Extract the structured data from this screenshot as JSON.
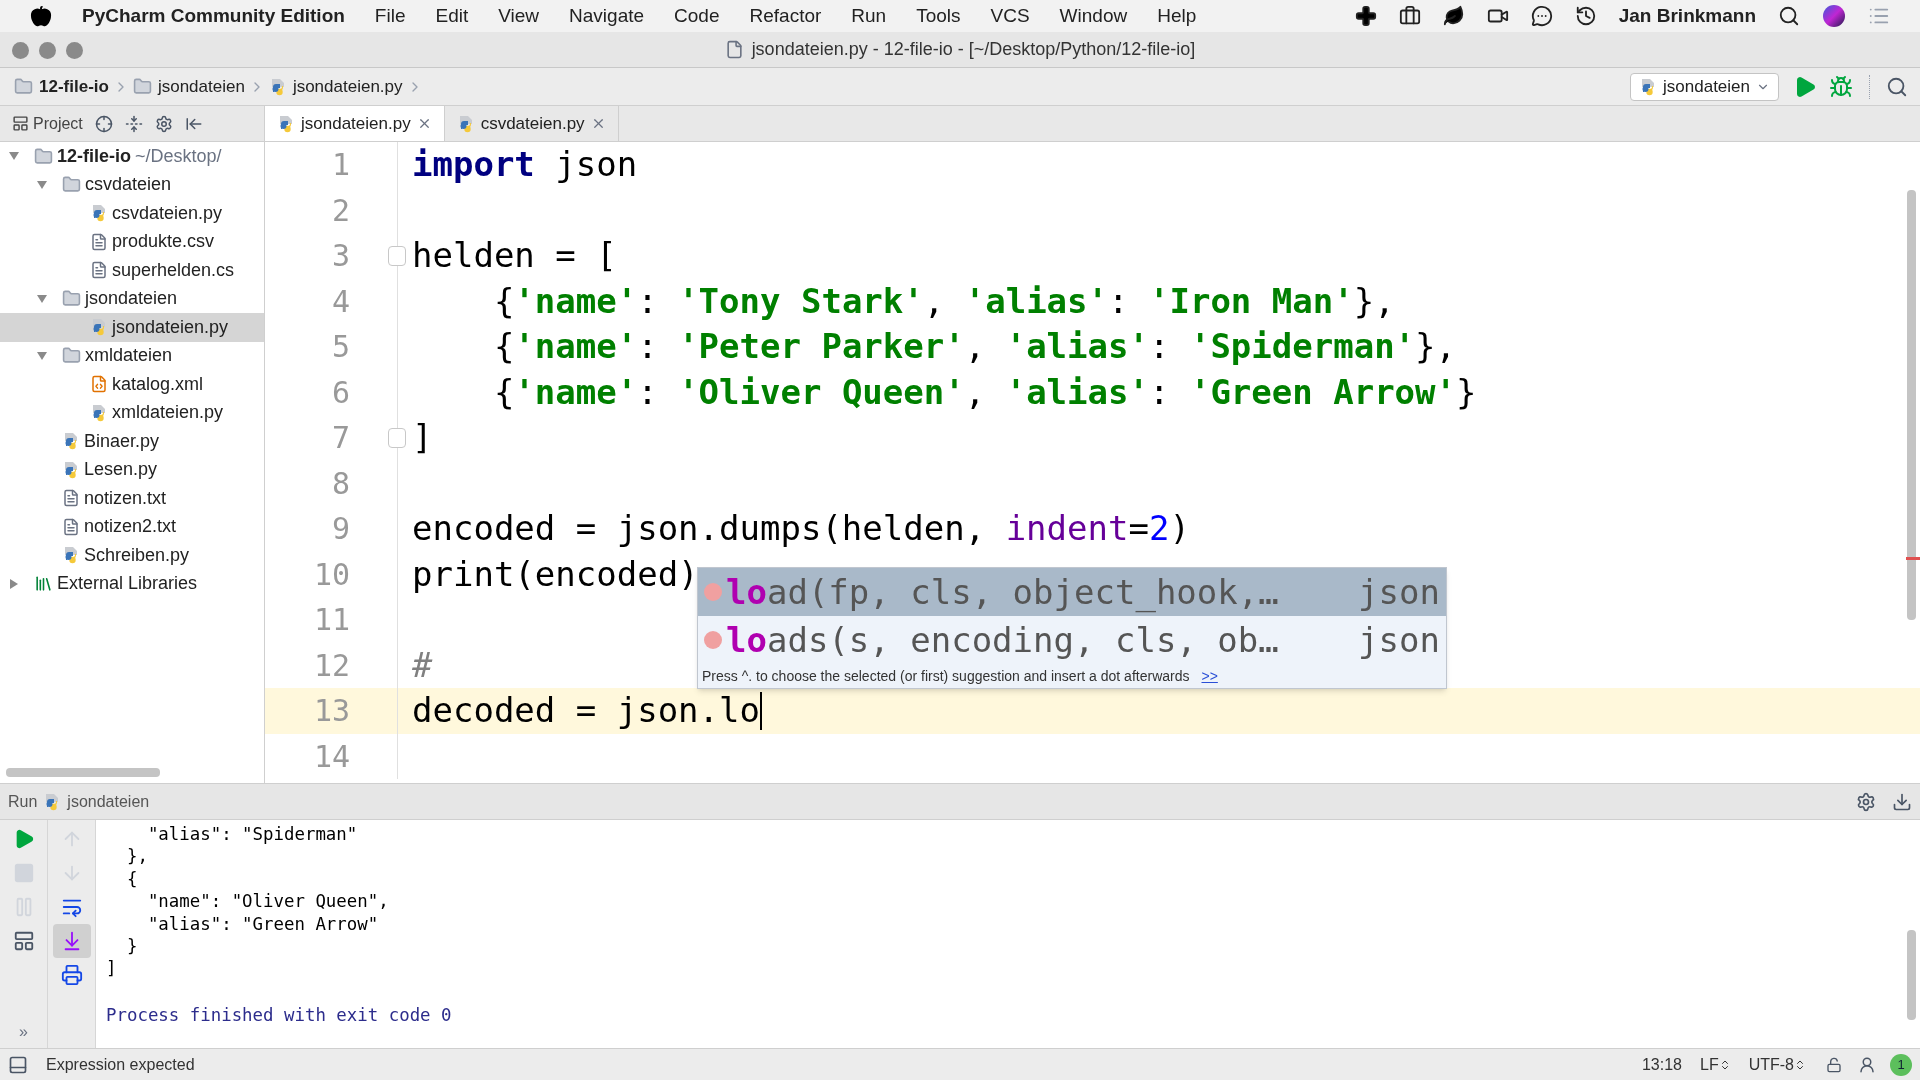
{
  "menu_bar": {
    "app_name": "PyCharm Community Edition",
    "menus": [
      "File",
      "Edit",
      "View",
      "Navigate",
      "Code",
      "Refactor",
      "Run",
      "Tools",
      "VCS",
      "Window",
      "Help"
    ],
    "user": "Jan Brinkmann"
  },
  "window": {
    "title": "jsondateien.py - 12-file-io - [~/Desktop/Python/12-file-io]"
  },
  "breadcrumbs": [
    {
      "label": "12-file-io",
      "kind": "folder"
    },
    {
      "label": "jsondateien",
      "kind": "folder"
    },
    {
      "label": "jsondateien.py",
      "kind": "python"
    }
  ],
  "run_config": {
    "label": "jsondateien"
  },
  "project_panel": {
    "label": "Project"
  },
  "tabs": [
    {
      "label": "jsondateien.py",
      "selected": true
    },
    {
      "label": "csvdateien.py",
      "selected": false
    }
  ],
  "project_tree": [
    {
      "name": "12-file-io",
      "suffix": "~/Desktop/",
      "kind": "root",
      "expanded": true,
      "selected": false,
      "children": [
        {
          "name": "csvdateien",
          "kind": "folder",
          "expanded": true,
          "selected": false,
          "children": [
            {
              "name": "csvdateien.py",
              "kind": "python",
              "selected": false
            },
            {
              "name": "produkte.csv",
              "kind": "text",
              "selected": false
            },
            {
              "name": "superhelden.cs",
              "kind": "text",
              "selected": false
            }
          ]
        },
        {
          "name": "jsondateien",
          "kind": "folder",
          "expanded": true,
          "selected": false,
          "children": [
            {
              "name": "jsondateien.py",
              "kind": "python",
              "selected": true
            }
          ]
        },
        {
          "name": "xmldateien",
          "kind": "folder",
          "expanded": true,
          "selected": false,
          "children": [
            {
              "name": "katalog.xml",
              "kind": "xml",
              "selected": false
            },
            {
              "name": "xmldateien.py",
              "kind": "python",
              "selected": false
            }
          ]
        },
        {
          "name": "Binaer.py",
          "kind": "python",
          "selected": false
        },
        {
          "name": "Lesen.py",
          "kind": "python",
          "selected": false
        },
        {
          "name": "notizen.txt",
          "kind": "text",
          "selected": false
        },
        {
          "name": "notizen2.txt",
          "kind": "text",
          "selected": false
        },
        {
          "name": "Schreiben.py",
          "kind": "python",
          "selected": false
        }
      ]
    },
    {
      "name": "External Libraries",
      "kind": "library",
      "expanded": false,
      "selected": false
    }
  ],
  "code_lines": [
    {
      "number": "1",
      "current": false,
      "fold": false,
      "tokens": [
        {
          "kind": "keyword",
          "text": "import"
        },
        {
          "kind": "plain",
          "text": " json"
        }
      ]
    },
    {
      "number": "2",
      "current": false,
      "fold": false
    },
    {
      "number": "3",
      "current": false,
      "fold": true,
      "tokens": [
        {
          "kind": "plain",
          "text": "helden = ["
        }
      ]
    },
    {
      "number": "4",
      "current": false,
      "fold": false,
      "tokens": [
        {
          "kind": "plain",
          "text": "    {"
        },
        {
          "kind": "string",
          "text": "'name'"
        },
        {
          "kind": "plain",
          "text": ": "
        },
        {
          "kind": "string",
          "text": "'Tony Stark'"
        },
        {
          "kind": "plain",
          "text": ", "
        },
        {
          "kind": "string",
          "text": "'alias'"
        },
        {
          "kind": "plain",
          "text": ": "
        },
        {
          "kind": "string",
          "text": "'Iron Man'"
        },
        {
          "kind": "plain",
          "text": "},"
        }
      ]
    },
    {
      "number": "5",
      "current": false,
      "fold": false,
      "tokens": [
        {
          "kind": "plain",
          "text": "    {"
        },
        {
          "kind": "string",
          "text": "'name'"
        },
        {
          "kind": "plain",
          "text": ": "
        },
        {
          "kind": "string",
          "text": "'Peter Parker'"
        },
        {
          "kind": "plain",
          "text": ", "
        },
        {
          "kind": "string",
          "text": "'alias'"
        },
        {
          "kind": "plain",
          "text": ": "
        },
        {
          "kind": "string",
          "text": "'Spiderman'"
        },
        {
          "kind": "plain",
          "text": "},"
        }
      ]
    },
    {
      "number": "6",
      "current": false,
      "fold": false,
      "tokens": [
        {
          "kind": "plain",
          "text": "    {"
        },
        {
          "kind": "string",
          "text": "'name'"
        },
        {
          "kind": "plain",
          "text": ": "
        },
        {
          "kind": "string",
          "text": "'Oliver Queen'"
        },
        {
          "kind": "plain",
          "text": ", "
        },
        {
          "kind": "string",
          "text": "'alias'"
        },
        {
          "kind": "plain",
          "text": ": "
        },
        {
          "kind": "string",
          "text": "'Green Arrow'"
        },
        {
          "kind": "plain",
          "text": "}"
        }
      ]
    },
    {
      "number": "7",
      "current": false,
      "fold": true,
      "tokens": [
        {
          "kind": "plain",
          "text": "]"
        }
      ]
    },
    {
      "number": "8",
      "current": false,
      "fold": false
    },
    {
      "number": "9",
      "current": false,
      "fold": false,
      "tokens": [
        {
          "kind": "plain",
          "text": "encoded = json.dumps(helden, "
        },
        {
          "kind": "param",
          "text": "indent"
        },
        {
          "kind": "plain",
          "text": "="
        },
        {
          "kind": "number",
          "text": "2"
        },
        {
          "kind": "plain",
          "text": ")"
        }
      ]
    },
    {
      "number": "10",
      "current": false,
      "fold": false,
      "tokens": [
        {
          "kind": "plain",
          "text": "print(encoded)"
        }
      ]
    },
    {
      "number": "11",
      "current": false,
      "fold": false
    },
    {
      "number": "12",
      "current": false,
      "fold": false,
      "tokens": [
        {
          "kind": "comment",
          "text": "#"
        }
      ]
    },
    {
      "number": "13",
      "current": true,
      "fold": false,
      "tokens": [
        {
          "kind": "plain",
          "text": "decoded = json.lo"
        }
      ]
    },
    {
      "number": "14",
      "current": false,
      "fold": false
    }
  ],
  "completion": {
    "items": [
      {
        "match": "lo",
        "rest": "ad(fp, cls, object_hook,…",
        "source": "json",
        "selected": true
      },
      {
        "match": "lo",
        "rest": "ads(s, encoding, cls, ob…",
        "source": "json",
        "selected": false
      }
    ],
    "hint": "Press ^. to choose the selected (or first) suggestion and insert a dot afterwards",
    "hint_link": ">>"
  },
  "run_panel": {
    "label": "Run",
    "config": "jsondateien",
    "left_tools": [
      {
        "kind": "rerun",
        "disabled": false,
        "pressed": false
      },
      {
        "kind": "stop",
        "disabled": true,
        "pressed": false
      },
      {
        "kind": "pause",
        "disabled": true,
        "pressed": false
      },
      {
        "kind": "layout",
        "disabled": false,
        "pressed": false
      }
    ],
    "right_tools": [
      {
        "kind": "up",
        "disabled": true,
        "pressed": false
      },
      {
        "kind": "down",
        "disabled": true,
        "pressed": false
      },
      {
        "kind": "wrap",
        "disabled": false,
        "pressed": false
      },
      {
        "kind": "scroll_end",
        "disabled": false,
        "pressed": true
      },
      {
        "kind": "print",
        "disabled": false,
        "pressed": false
      }
    ],
    "more": "»",
    "output": [
      {
        "kind": "plain",
        "text": "    \"alias\": \"Spiderman\""
      },
      {
        "kind": "plain",
        "text": "  },"
      },
      {
        "kind": "plain",
        "text": "  {"
      },
      {
        "kind": "plain",
        "text": "    \"name\": \"Oliver Queen\","
      },
      {
        "kind": "plain",
        "text": "    \"alias\": \"Green Arrow\""
      },
      {
        "kind": "plain",
        "text": "  }"
      },
      {
        "kind": "plain",
        "text": "]"
      },
      {
        "kind": "blank"
      },
      {
        "kind": "exit",
        "text": "Process finished with exit code 0"
      }
    ]
  },
  "status_bar": {
    "message": "Expression expected",
    "position": "13:18",
    "line_separator": "LF",
    "encoding": "UTF-8",
    "notifications": "1"
  }
}
